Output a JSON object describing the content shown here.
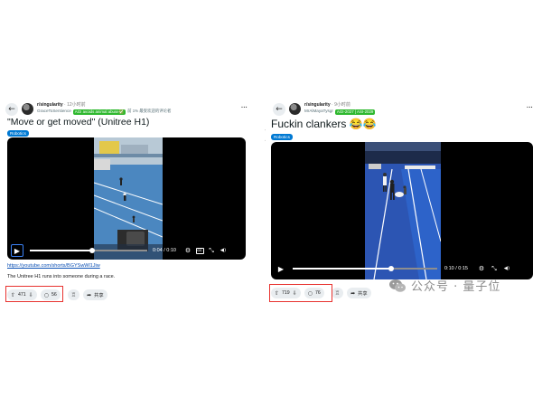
{
  "left_post": {
    "subreddit": "r/singularity",
    "separator": " · ",
    "time": "12小时前",
    "author": "GraceToSentience",
    "author_flair": "AGI avoids animal abuse✅",
    "stat_flair": "前 1% 最受欢迎的评论者",
    "title": "\"Move or get moved\" (Unitree H1)",
    "tag": "Robotics",
    "timecode": "0:04 / 0:10",
    "progress": 0.4,
    "link": "https://youtube.com/shorts/BGYSwWl1Jiw",
    "description": "The Unitree H1 runs into someone during a race.",
    "upvotes": "471",
    "comments": "56",
    "share_label": "共享",
    "highlight_color": "#e8322f"
  },
  "right_post": {
    "subreddit": "r/singularity",
    "separator": " · ",
    "time": "9小时前",
    "author": "MrAlMayaTysgr",
    "author_flair": "AGI-2027 | ASI-2029",
    "title": "Fuckin clankers 😂😂",
    "tag": "Robotics",
    "timecode": "0:10 / 0:15",
    "progress": 0.67,
    "upvotes": "719",
    "comments": "76",
    "share_label": "共享",
    "highlight_color": "#e8322f"
  },
  "icons": {
    "back": "arrow-left-icon",
    "more": "more-horizontal-icon",
    "play": "play-icon",
    "settings": "gear-icon",
    "captions": "cc-icon",
    "fullscreen": "expand-icon",
    "volume": "volume-icon",
    "upvote": "upvote-icon",
    "downvote": "downvote-icon",
    "comment": "comment-icon",
    "award": "award-icon",
    "share": "share-icon"
  },
  "icon_glyphs": {
    "back": "←",
    "more": "···",
    "side": "❯",
    "play": "▶",
    "settings": "⚙",
    "captions": "CC",
    "fullscreen": "⤡",
    "volume": "◀)",
    "upvote": "⇧",
    "downvote": "⇩",
    "comment": "○",
    "award": "♖",
    "share": "➦"
  },
  "watermark": {
    "text": "公众号 · 量子位",
    "color": "#8c8c8c"
  },
  "colors": {
    "reddit_blue": "#0079d3",
    "flair_green": "#2eb82e",
    "video_bg": "#000000"
  }
}
